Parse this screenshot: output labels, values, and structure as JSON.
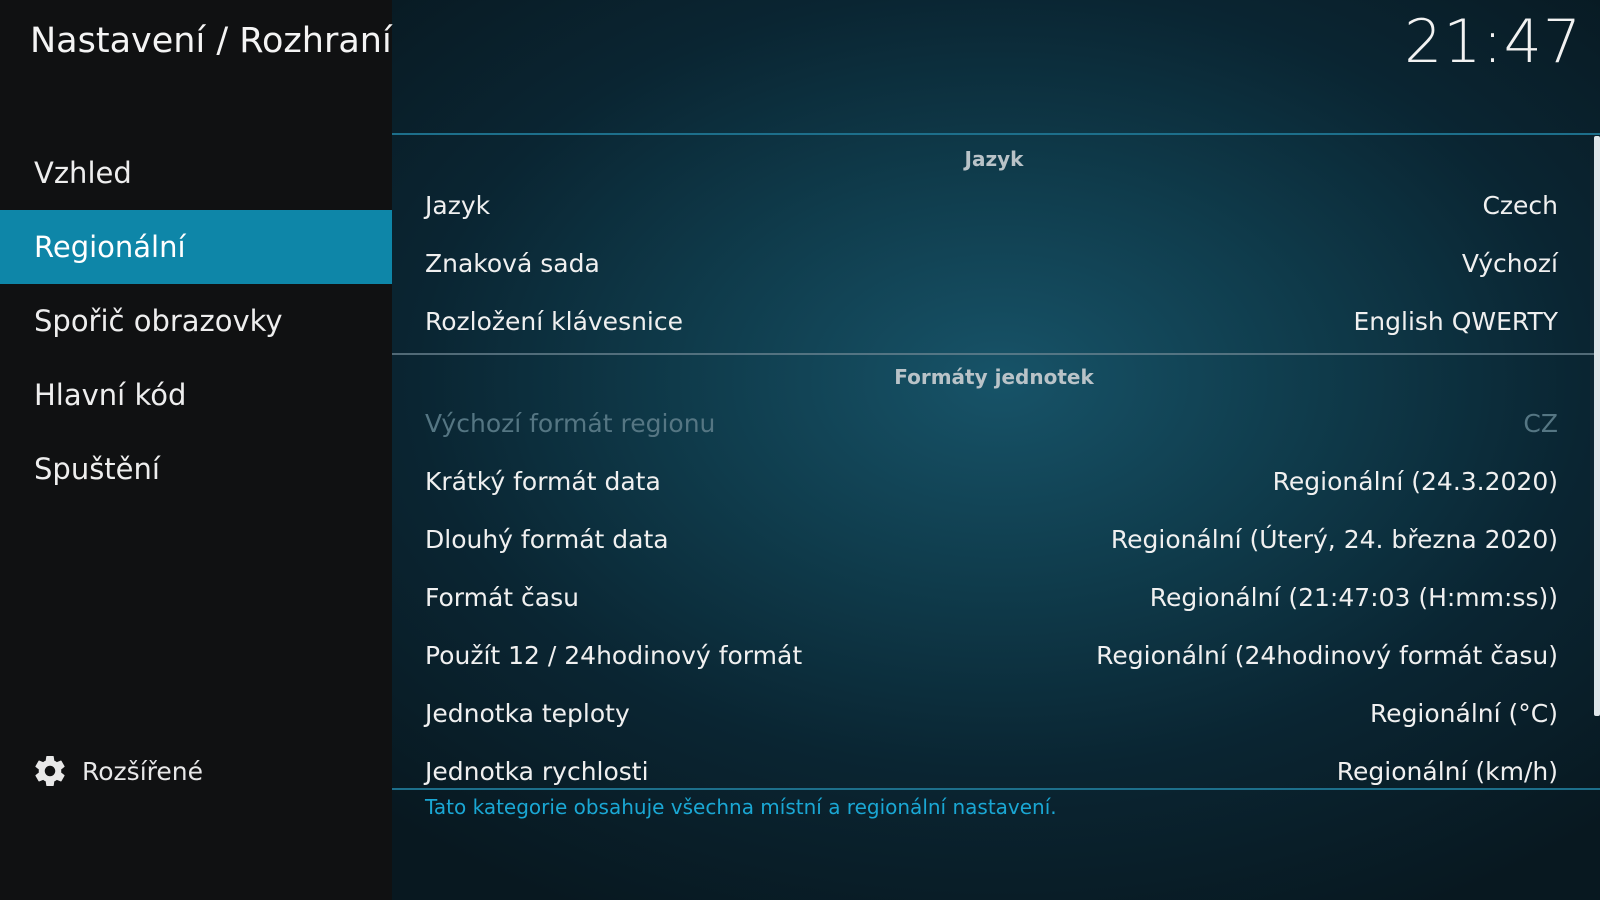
{
  "header": {
    "title": "Nastavení / Rozhraní",
    "clock": "21:47"
  },
  "sidebar": {
    "items": [
      {
        "label": "Vzhled",
        "active": false
      },
      {
        "label": "Regionální",
        "active": true
      },
      {
        "label": "Spořič obrazovky",
        "active": false
      },
      {
        "label": "Hlavní kód",
        "active": false
      },
      {
        "label": "Spuštění",
        "active": false
      }
    ],
    "advanced": {
      "label": "Rozšířené",
      "icon": "gear-icon"
    }
  },
  "groups": [
    {
      "header": "Jazyk",
      "settings": [
        {
          "label": "Jazyk",
          "value": "Czech",
          "enabled": true
        },
        {
          "label": "Znaková sada",
          "value": "Výchozí",
          "enabled": true
        },
        {
          "label": "Rozložení klávesnice",
          "value": "English QWERTY",
          "enabled": true
        }
      ]
    },
    {
      "header": "Formáty jednotek",
      "settings": [
        {
          "label": "Výchozí formát regionu",
          "value": "CZ",
          "enabled": false
        },
        {
          "label": "Krátký formát data",
          "value": "Regionální (24.3.2020)",
          "enabled": true
        },
        {
          "label": "Dlouhý formát data",
          "value": "Regionální (Úterý, 24. března 2020)",
          "enabled": true
        },
        {
          "label": "Formát času",
          "value": "Regionální (21:47:03 (H:mm:ss))",
          "enabled": true
        },
        {
          "label": "Použít 12 / 24hodinový formát",
          "value": "Regionální (24hodinový formát času)",
          "enabled": true
        },
        {
          "label": "Jednotka teploty",
          "value": "Regionální (°C)",
          "enabled": true
        },
        {
          "label": "Jednotka rychlosti",
          "value": "Regionální (km/h)",
          "enabled": true
        }
      ]
    }
  ],
  "description": "Tato kategorie obsahuje všechna místní a regionální nastavení.",
  "colors": {
    "accent": "#0e86a8",
    "description_text": "#1aa7d4",
    "sidebar_bg": "#101112"
  }
}
